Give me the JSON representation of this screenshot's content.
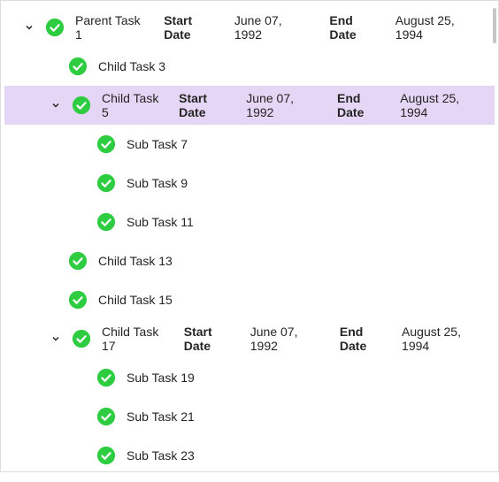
{
  "labels": {
    "start_date": "Start Date",
    "end_date": "End Date"
  },
  "rows": [
    {
      "id": "parent1",
      "name": "Parent Task 1",
      "indent": 0,
      "chevron": true,
      "selected": false,
      "start": "June 07, 1992",
      "end": "August 25, 1994"
    },
    {
      "id": "child3",
      "name": "Child Task 3",
      "indent": 1,
      "chevron": false,
      "selected": false
    },
    {
      "id": "child5",
      "name": "Child Task 5",
      "indent": 1,
      "chevron": true,
      "selected": true,
      "start": "June 07, 1992",
      "end": "August 25, 1994"
    },
    {
      "id": "sub7",
      "name": "Sub Task 7",
      "indent": 2,
      "chevron": false,
      "selected": false
    },
    {
      "id": "sub9",
      "name": "Sub Task 9",
      "indent": 2,
      "chevron": false,
      "selected": false
    },
    {
      "id": "sub11",
      "name": "Sub Task 11",
      "indent": 2,
      "chevron": false,
      "selected": false
    },
    {
      "id": "child13",
      "name": "Child Task 13",
      "indent": 1,
      "chevron": false,
      "selected": false
    },
    {
      "id": "child15",
      "name": "Child Task 15",
      "indent": 1,
      "chevron": false,
      "selected": false
    },
    {
      "id": "child17",
      "name": "Child Task 17",
      "indent": 1,
      "chevron": true,
      "selected": false,
      "start": "June 07, 1992",
      "end": "August 25, 1994"
    },
    {
      "id": "sub19",
      "name": "Sub Task 19",
      "indent": 2,
      "chevron": false,
      "selected": false
    },
    {
      "id": "sub21",
      "name": "Sub Task 21",
      "indent": 2,
      "chevron": false,
      "selected": false
    },
    {
      "id": "sub23",
      "name": "Sub Task 23",
      "indent": 2,
      "chevron": false,
      "selected": false
    }
  ]
}
